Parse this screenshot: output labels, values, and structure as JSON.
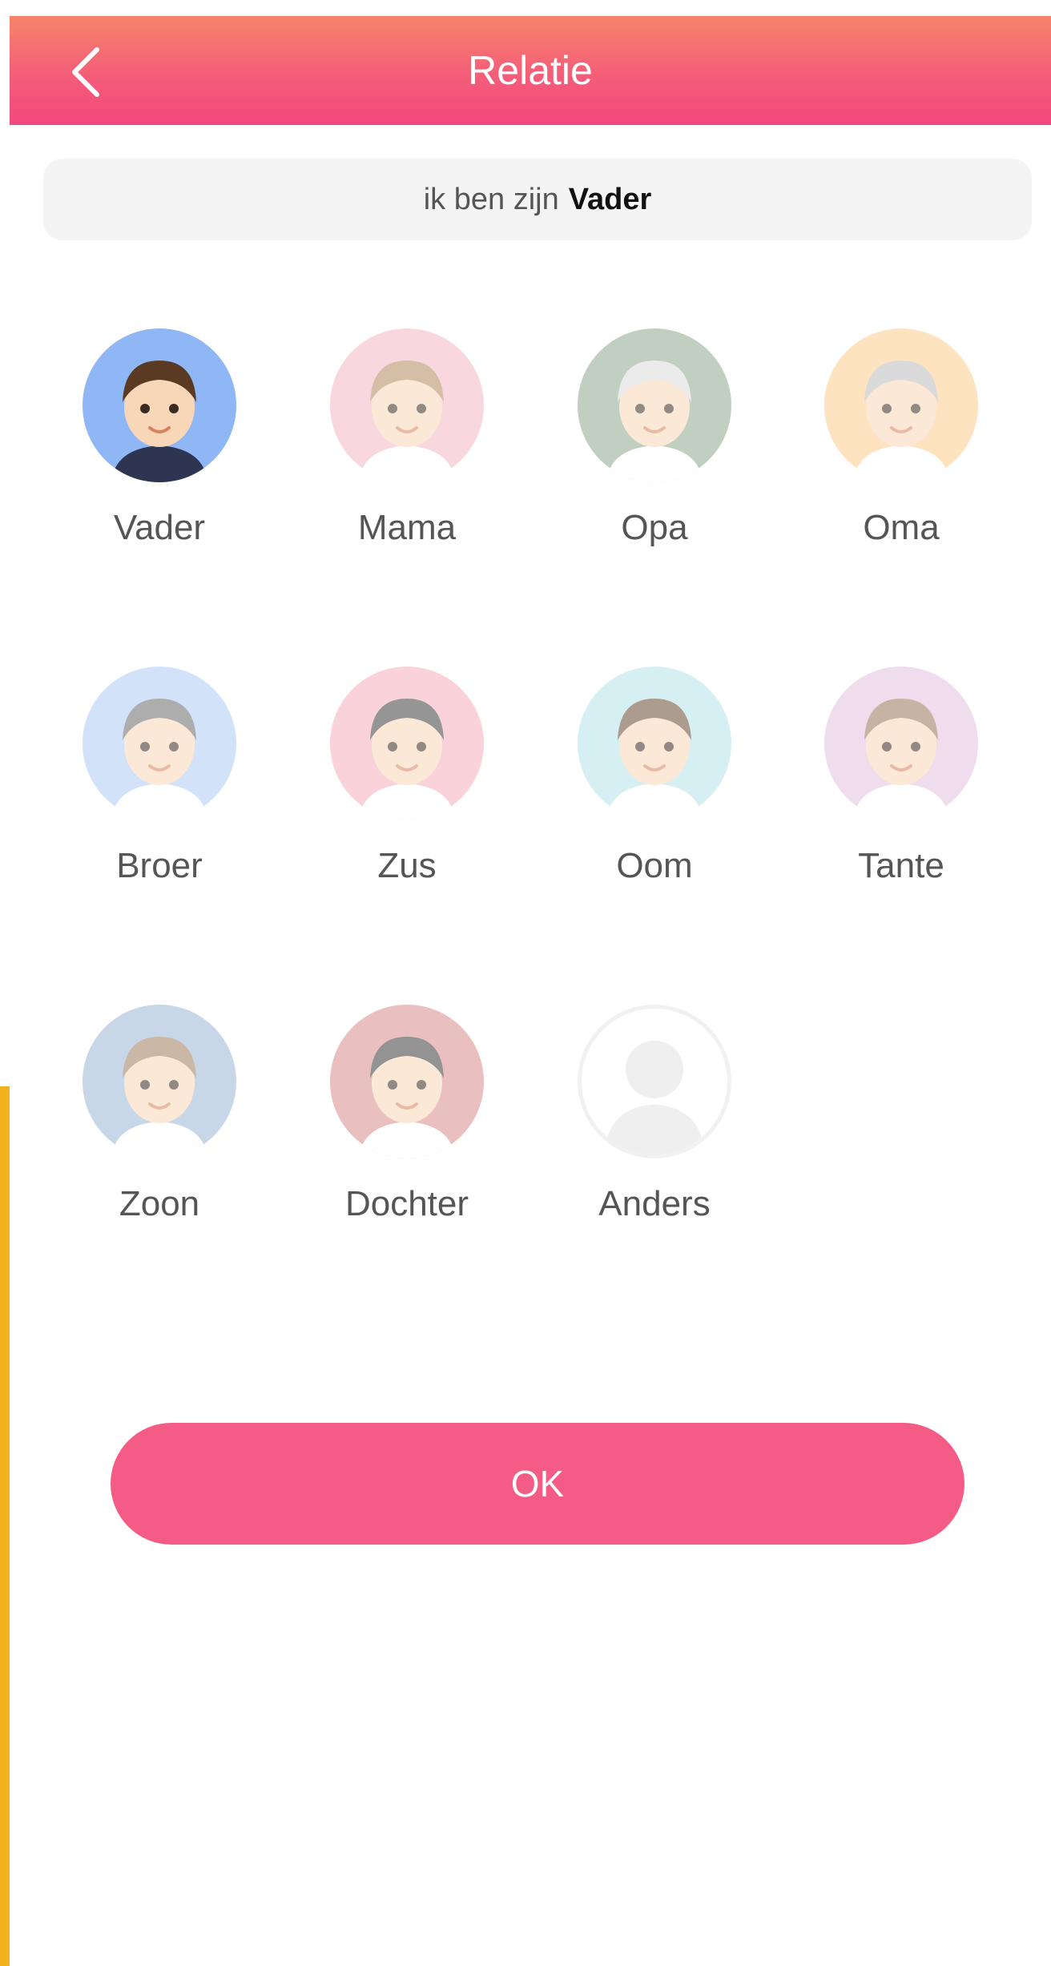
{
  "header": {
    "title": "Relatie",
    "back_icon": "chevron-left-icon",
    "gradient_top": "#f6846a",
    "gradient_bottom": "#f2497c"
  },
  "banner": {
    "prefix": "ik ben zijn",
    "selected": "Vader"
  },
  "relations": [
    {
      "label": "Vader",
      "selected": true,
      "bg": "#8fb6f5"
    },
    {
      "label": "Mama",
      "selected": false,
      "bg": "#f5b7c4"
    },
    {
      "label": "Opa",
      "selected": false,
      "bg": "#8fa890"
    },
    {
      "label": "Oma",
      "selected": false,
      "bg": "#fccd8c"
    },
    {
      "label": "Broer",
      "selected": false,
      "bg": "#aecbf4"
    },
    {
      "label": "Zus",
      "selected": false,
      "bg": "#f5aebd"
    },
    {
      "label": "Oom",
      "selected": false,
      "bg": "#b6e3ea"
    },
    {
      "label": "Tante",
      "selected": false,
      "bg": "#e2c0de"
    },
    {
      "label": "Zoon",
      "selected": false,
      "bg": "#9cb8d6"
    },
    {
      "label": "Dochter",
      "selected": false,
      "bg": "#d88b8b"
    },
    {
      "label": "Anders",
      "selected": false,
      "bg": "#ffffff"
    }
  ],
  "ok_button": {
    "label": "OK",
    "color": "#f45c86"
  }
}
